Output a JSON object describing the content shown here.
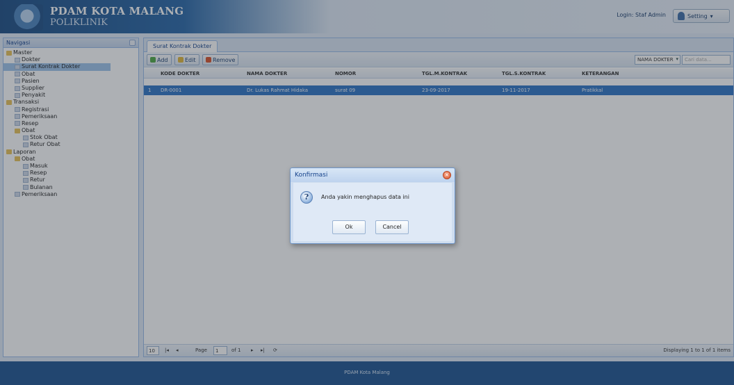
{
  "header": {
    "title": "PDAM KOTA MALANG",
    "subtitle": "POLIKLINIK",
    "login_text": "Login: Staf Admin",
    "setting_label": "Setting"
  },
  "nav": {
    "title": "Navigasi",
    "tree": [
      {
        "label": "Master",
        "level": 0,
        "type": "folder"
      },
      {
        "label": "Dokter",
        "level": 1,
        "type": "leaf"
      },
      {
        "label": "Surat Kontrak Dokter",
        "level": 1,
        "type": "leaf",
        "selected": true
      },
      {
        "label": "Obat",
        "level": 1,
        "type": "leaf"
      },
      {
        "label": "Pasien",
        "level": 1,
        "type": "leaf"
      },
      {
        "label": "Supplier",
        "level": 1,
        "type": "leaf"
      },
      {
        "label": "Penyakit",
        "level": 1,
        "type": "leaf"
      },
      {
        "label": "Transaksi",
        "level": 0,
        "type": "folder"
      },
      {
        "label": "Registrasi",
        "level": 1,
        "type": "leaf"
      },
      {
        "label": "Pemeriksaan",
        "level": 1,
        "type": "leaf"
      },
      {
        "label": "Resep",
        "level": 1,
        "type": "leaf"
      },
      {
        "label": "Obat",
        "level": 1,
        "type": "folder"
      },
      {
        "label": "Stok Obat",
        "level": 2,
        "type": "leaf"
      },
      {
        "label": "Retur Obat",
        "level": 2,
        "type": "leaf"
      },
      {
        "label": "Laporan",
        "level": 0,
        "type": "folder"
      },
      {
        "label": "Obat",
        "level": 1,
        "type": "folder"
      },
      {
        "label": "Masuk",
        "level": 2,
        "type": "leaf"
      },
      {
        "label": "Resep",
        "level": 2,
        "type": "leaf"
      },
      {
        "label": "Retur",
        "level": 2,
        "type": "leaf"
      },
      {
        "label": "Bulanan",
        "level": 2,
        "type": "leaf"
      },
      {
        "label": "Pemeriksaan",
        "level": 1,
        "type": "leaf"
      }
    ]
  },
  "tab": {
    "label": "Surat Kontrak Dokter"
  },
  "toolbar": {
    "add_label": "Add",
    "edit_label": "Edit",
    "remove_label": "Remove",
    "search_field": "NAMA DOKTER",
    "search_placeholder": "Cari data..."
  },
  "grid": {
    "columns": [
      "KODE DOKTER",
      "NAMA DOKTER",
      "NOMOR",
      "TGL.M.KONTRAK",
      "TGL.S.KONTRAK",
      "KETERANGAN"
    ],
    "rows": [
      {
        "num": "1",
        "cells": [
          "DR-0001",
          "Dr. Lukas Rahmat Hidaka",
          "surat 09",
          "23-09-2017",
          "19-11-2017",
          "Pratikkal"
        ]
      }
    ]
  },
  "pager": {
    "page_size": "10",
    "page_label": "Page",
    "page_value": "1",
    "of_label": "of 1",
    "display_text": "Displaying 1 to 1 of 1 items"
  },
  "footer": {
    "text": "PDAM Kota Malang"
  },
  "dialog": {
    "title": "Konfirmasi",
    "message": "Anda yakin menghapus data ini",
    "ok_label": "Ok",
    "cancel_label": "Cancel",
    "icon": "question-icon"
  },
  "colors": {
    "header_blue": "#1d4e85",
    "selection_blue": "#2f74c6",
    "panel_border": "#99bbe8",
    "footer_blue": "#1f5592"
  }
}
